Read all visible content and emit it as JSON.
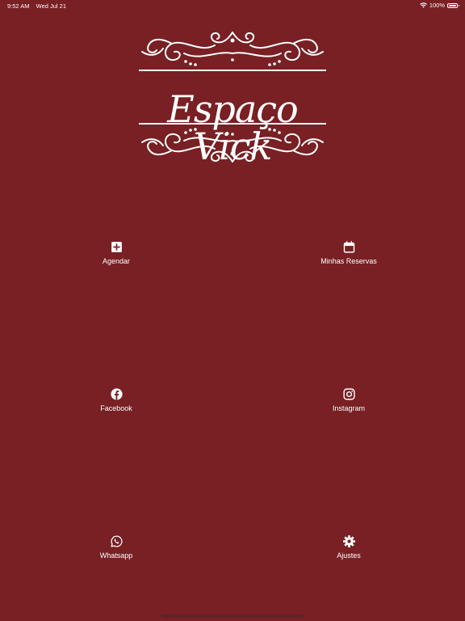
{
  "status_bar": {
    "time": "9:52 AM",
    "date": "Wed Jul 21",
    "battery": "100%",
    "battery_level": 1.0,
    "icons": [
      "wifi-icon",
      "battery-icon"
    ]
  },
  "brand": {
    "name": "Espaço Vick"
  },
  "colors": {
    "background": "#782024",
    "foreground": "#ffffff"
  },
  "menu": {
    "items": [
      {
        "label": "Agendar",
        "icon": "plus-square-icon"
      },
      {
        "label": "Minhas Reservas",
        "icon": "calendar-icon"
      },
      {
        "label": "Facebook",
        "icon": "facebook-icon"
      },
      {
        "label": "Instagram",
        "icon": "instagram-icon"
      },
      {
        "label": "Whatsapp",
        "icon": "whatsapp-icon"
      },
      {
        "label": "Ajustes",
        "icon": "gear-icon"
      }
    ]
  }
}
